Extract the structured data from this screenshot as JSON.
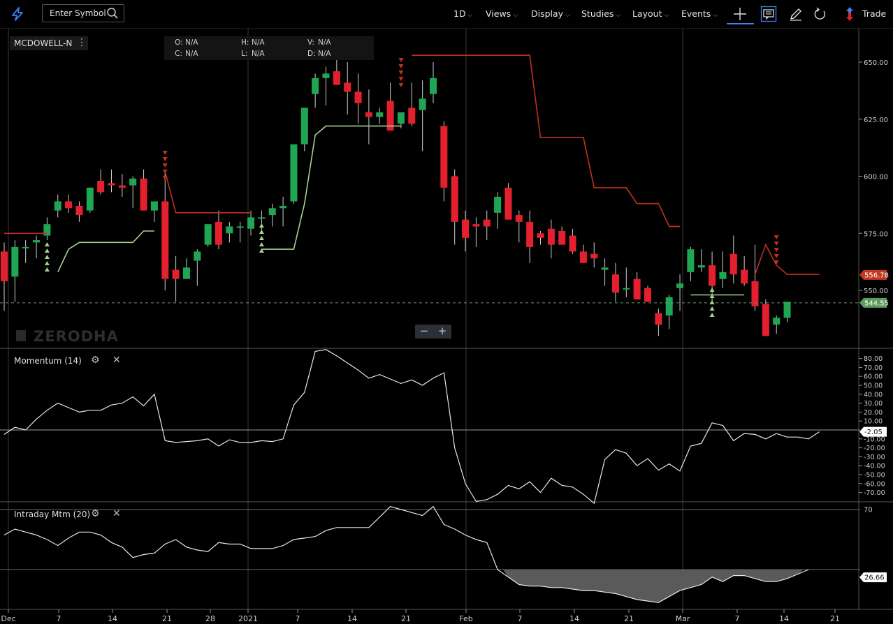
{
  "toolbar": {
    "search_placeholder": "Enter Symbol",
    "menus": [
      {
        "id": "interval",
        "label": "1D"
      },
      {
        "id": "views",
        "label": "Views"
      },
      {
        "id": "display",
        "label": "Display"
      },
      {
        "id": "studies",
        "label": "Studies"
      },
      {
        "id": "layout",
        "label": "Layout"
      },
      {
        "id": "events",
        "label": "Events"
      }
    ],
    "trade_label": "Trade",
    "icons": [
      "lightning-logo-icon",
      "search-icon",
      "crosshair-icon",
      "comment-icon",
      "pencil-icon",
      "refresh-icon",
      "trade-arrows-icon"
    ]
  },
  "symbol": "MCDOWELL-N",
  "ohlc": {
    "o_label": "O:",
    "o": "N/A",
    "h_label": "H:",
    "h": "N/A",
    "v_label": "V:",
    "v": "N/A",
    "c_label": "C:",
    "c": "N/A",
    "l_label": "L:",
    "l": "N/A",
    "d_label": "D:",
    "d": "N/A"
  },
  "watermark": "ZERODHA",
  "zoom": {
    "minus": "−",
    "plus": "+"
  },
  "colors": {
    "up": "#1fa655",
    "down": "#e5202e",
    "supertrend_up": "#a8d08d",
    "supertrend_down": "#c0301f",
    "badge_red": "#c0381f",
    "badge_green": "#5d9a5d",
    "accent": "#3b82f6"
  },
  "chart_data": [
    {
      "type": "candlestick",
      "title": "MCDOWELL-N",
      "x_tick_labels": [
        "Dec",
        "7",
        "14",
        "21",
        "28",
        "2021",
        "7",
        "14",
        "21",
        "Feb",
        "7",
        "14",
        "21",
        "Mar",
        "7",
        "14",
        "21"
      ],
      "y_ticks": [
        550,
        575,
        600,
        625,
        650
      ],
      "ylim": [
        527,
        662
      ],
      "last_price": "544.55",
      "stop_price": "556.78",
      "candles": [
        {
          "o": 567,
          "h": 571,
          "l": 541,
          "c": 554
        },
        {
          "o": 556,
          "h": 572,
          "l": 545,
          "c": 569
        },
        {
          "o": 569,
          "h": 572,
          "l": 562,
          "c": 569
        },
        {
          "o": 571,
          "h": 574,
          "l": 564,
          "c": 572
        },
        {
          "o": 574,
          "h": 582,
          "l": 572,
          "c": 579
        },
        {
          "o": 585,
          "h": 592,
          "l": 582,
          "c": 589
        },
        {
          "o": 589,
          "h": 592,
          "l": 584,
          "c": 586
        },
        {
          "o": 587,
          "h": 589,
          "l": 580,
          "c": 583
        },
        {
          "o": 585,
          "h": 595,
          "l": 584,
          "c": 595
        },
        {
          "o": 598,
          "h": 603,
          "l": 592,
          "c": 593
        },
        {
          "o": 597,
          "h": 603,
          "l": 593,
          "c": 596
        },
        {
          "o": 596,
          "h": 601,
          "l": 591,
          "c": 595
        },
        {
          "o": 596,
          "h": 600,
          "l": 586,
          "c": 599
        },
        {
          "o": 599,
          "h": 603,
          "l": 586,
          "c": 585
        },
        {
          "o": 585,
          "h": 589,
          "l": 580,
          "c": 589
        },
        {
          "o": 589,
          "h": 602,
          "l": 550,
          "c": 555
        },
        {
          "o": 559,
          "h": 565,
          "l": 545,
          "c": 555
        },
        {
          "o": 555,
          "h": 564,
          "l": 555,
          "c": 560
        },
        {
          "o": 563,
          "h": 568,
          "l": 552,
          "c": 567
        },
        {
          "o": 570,
          "h": 579,
          "l": 569,
          "c": 579
        },
        {
          "o": 580,
          "h": 585,
          "l": 568,
          "c": 570
        },
        {
          "o": 575,
          "h": 580,
          "l": 571,
          "c": 578
        },
        {
          "o": 578,
          "h": 580,
          "l": 571,
          "c": 578
        },
        {
          "o": 577,
          "h": 585,
          "l": 574,
          "c": 582
        },
        {
          "o": 582,
          "h": 585,
          "l": 575,
          "c": 582
        },
        {
          "o": 583,
          "h": 588,
          "l": 578,
          "c": 586
        },
        {
          "o": 586,
          "h": 591,
          "l": 578,
          "c": 587
        },
        {
          "o": 589,
          "h": 604,
          "l": 588,
          "c": 614
        },
        {
          "o": 614,
          "h": 627,
          "l": 611,
          "c": 630
        },
        {
          "o": 636,
          "h": 645,
          "l": 630,
          "c": 643
        },
        {
          "o": 643,
          "h": 648,
          "l": 631,
          "c": 645
        },
        {
          "o": 646,
          "h": 655,
          "l": 641,
          "c": 640
        },
        {
          "o": 641,
          "h": 650,
          "l": 627,
          "c": 637
        },
        {
          "o": 637,
          "h": 645,
          "l": 623,
          "c": 632
        },
        {
          "o": 628,
          "h": 638,
          "l": 614,
          "c": 626
        },
        {
          "o": 626,
          "h": 630,
          "l": 623,
          "c": 628
        },
        {
          "o": 633,
          "h": 641,
          "l": 620,
          "c": 620
        },
        {
          "o": 623,
          "h": 628,
          "l": 621,
          "c": 628
        },
        {
          "o": 630,
          "h": 641,
          "l": 622,
          "c": 623
        },
        {
          "o": 629,
          "h": 642,
          "l": 611,
          "c": 634
        },
        {
          "o": 636,
          "h": 650,
          "l": 632,
          "c": 643
        },
        {
          "o": 622,
          "h": 624,
          "l": 589,
          "c": 595
        },
        {
          "o": 600,
          "h": 603,
          "l": 570,
          "c": 580
        },
        {
          "o": 581,
          "h": 585,
          "l": 567,
          "c": 573
        },
        {
          "o": 579,
          "h": 582,
          "l": 569,
          "c": 578
        },
        {
          "o": 581,
          "h": 585,
          "l": 572,
          "c": 578
        },
        {
          "o": 584,
          "h": 593,
          "l": 577,
          "c": 591
        },
        {
          "o": 595,
          "h": 597,
          "l": 581,
          "c": 581
        },
        {
          "o": 583,
          "h": 585,
          "l": 571,
          "c": 580
        },
        {
          "o": 580,
          "h": 585,
          "l": 562,
          "c": 569
        },
        {
          "o": 575,
          "h": 576,
          "l": 570,
          "c": 573
        },
        {
          "o": 577,
          "h": 581,
          "l": 564,
          "c": 570
        },
        {
          "o": 576,
          "h": 578,
          "l": 571,
          "c": 570
        },
        {
          "o": 574,
          "h": 577,
          "l": 566,
          "c": 567
        },
        {
          "o": 567,
          "h": 570,
          "l": 563,
          "c": 562
        },
        {
          "o": 566,
          "h": 571,
          "l": 560,
          "c": 564
        },
        {
          "o": 559,
          "h": 564,
          "l": 552,
          "c": 560
        },
        {
          "o": 557,
          "h": 562,
          "l": 545,
          "c": 549
        },
        {
          "o": 551,
          "h": 560,
          "l": 547,
          "c": 551
        },
        {
          "o": 555,
          "h": 558,
          "l": 548,
          "c": 546
        },
        {
          "o": 551,
          "h": 552,
          "l": 545,
          "c": 545
        },
        {
          "o": 540,
          "h": 542,
          "l": 530,
          "c": 535
        },
        {
          "o": 539,
          "h": 548,
          "l": 533,
          "c": 547
        },
        {
          "o": 551,
          "h": 557,
          "l": 541,
          "c": 553
        },
        {
          "o": 558,
          "h": 569,
          "l": 554,
          "c": 568
        },
        {
          "o": 560,
          "h": 568,
          "l": 558,
          "c": 561
        },
        {
          "o": 561,
          "h": 567,
          "l": 544,
          "c": 552
        },
        {
          "o": 555,
          "h": 567,
          "l": 551,
          "c": 558
        },
        {
          "o": 566,
          "h": 574,
          "l": 553,
          "c": 557
        },
        {
          "o": 559,
          "h": 565,
          "l": 552,
          "c": 553
        },
        {
          "o": 554,
          "h": 570,
          "l": 541,
          "c": 543
        },
        {
          "o": 544,
          "h": 546,
          "l": 530,
          "c": 530
        },
        {
          "o": 535,
          "h": 539,
          "l": 531,
          "c": 538
        },
        {
          "o": 538,
          "h": 545,
          "l": 536,
          "c": 545
        }
      ],
      "supertrend": [
        575,
        575,
        575,
        575,
        575,
        575,
        575,
        575,
        575,
        575,
        575,
        575,
        575,
        575,
        575,
        602,
        584,
        584,
        584,
        584,
        584,
        584,
        584,
        584,
        584,
        584,
        584,
        584,
        573,
        573,
        573,
        573,
        573,
        573,
        573,
        573,
        573,
        573,
        653,
        653,
        653,
        653,
        653,
        653,
        653,
        653,
        653,
        653,
        653,
        653,
        617,
        617,
        617,
        617,
        617,
        595,
        595,
        595,
        595,
        588,
        588,
        588,
        578,
        578,
        578,
        570,
        570,
        570,
        557,
        557,
        557,
        570,
        561,
        557,
        557,
        557,
        557
      ],
      "supertrend_up": [
        null,
        null,
        null,
        null,
        null,
        558,
        568,
        571,
        571,
        571,
        571,
        571,
        571,
        576,
        576,
        null,
        null,
        null,
        null,
        null,
        null,
        null,
        null,
        null,
        568,
        568,
        568,
        568,
        588,
        618,
        622,
        622,
        622,
        622,
        622,
        622,
        622,
        622,
        null,
        null,
        null,
        null,
        null,
        null,
        null,
        null,
        null,
        null,
        null,
        null,
        null,
        null,
        null,
        null,
        null,
        null,
        null,
        null,
        null,
        null,
        null,
        null,
        null,
        null,
        548,
        548,
        548,
        548,
        548,
        548,
        null,
        null,
        null,
        null,
        null,
        null,
        null
      ]
    },
    {
      "type": "line",
      "title": "Momentum (14)",
      "ylabel_ticks": [
        80,
        70,
        60,
        50,
        40,
        30,
        20,
        10,
        -10,
        -20,
        -30,
        -40,
        -50,
        -60,
        -70
      ],
      "ylim": [
        -82,
        90
      ],
      "last_value": "-2.05",
      "values": [
        -5,
        3,
        0,
        12,
        22,
        30,
        25,
        20,
        22,
        22,
        28,
        30,
        37,
        27,
        40,
        -12,
        -14,
        -13,
        -12,
        -10,
        -18,
        -11,
        -14,
        -14,
        -12,
        -13,
        -10,
        28,
        42,
        88,
        90,
        83,
        75,
        67,
        58,
        62,
        57,
        52,
        56,
        50,
        58,
        64,
        -20,
        -60,
        -80,
        -78,
        -72,
        -62,
        -66,
        -58,
        -70,
        -54,
        -62,
        -64,
        -72,
        -82,
        -33,
        -22,
        -26,
        -40,
        -32,
        -45,
        -38,
        -46,
        -18,
        -15,
        8,
        5,
        -12,
        -4,
        -5,
        -10,
        -4,
        -8,
        -8,
        -10,
        -2
      ],
      "zero_line": 0
    },
    {
      "type": "area",
      "title": "Intraday Mtm (20)",
      "last_value": "26.66",
      "y_ticks_visible": [
        "70"
      ],
      "ylim": [
        10,
        75
      ],
      "baseline": 30,
      "values": [
        53,
        57,
        55,
        53,
        50,
        46,
        51,
        55,
        55,
        53,
        48,
        45,
        38,
        40,
        41,
        47,
        50,
        45,
        43,
        42,
        48,
        47,
        47,
        44,
        44,
        44,
        46,
        50,
        51,
        52,
        56,
        58,
        58,
        58,
        58,
        65,
        72,
        70,
        68,
        66,
        72,
        60,
        57,
        53,
        50,
        48,
        30,
        25,
        20,
        19,
        19,
        18,
        18,
        17,
        16,
        16,
        15,
        14,
        12,
        10,
        9,
        8,
        12,
        16,
        18,
        20,
        25,
        22,
        26,
        26,
        24,
        22,
        22,
        24,
        27,
        30
      ]
    }
  ]
}
